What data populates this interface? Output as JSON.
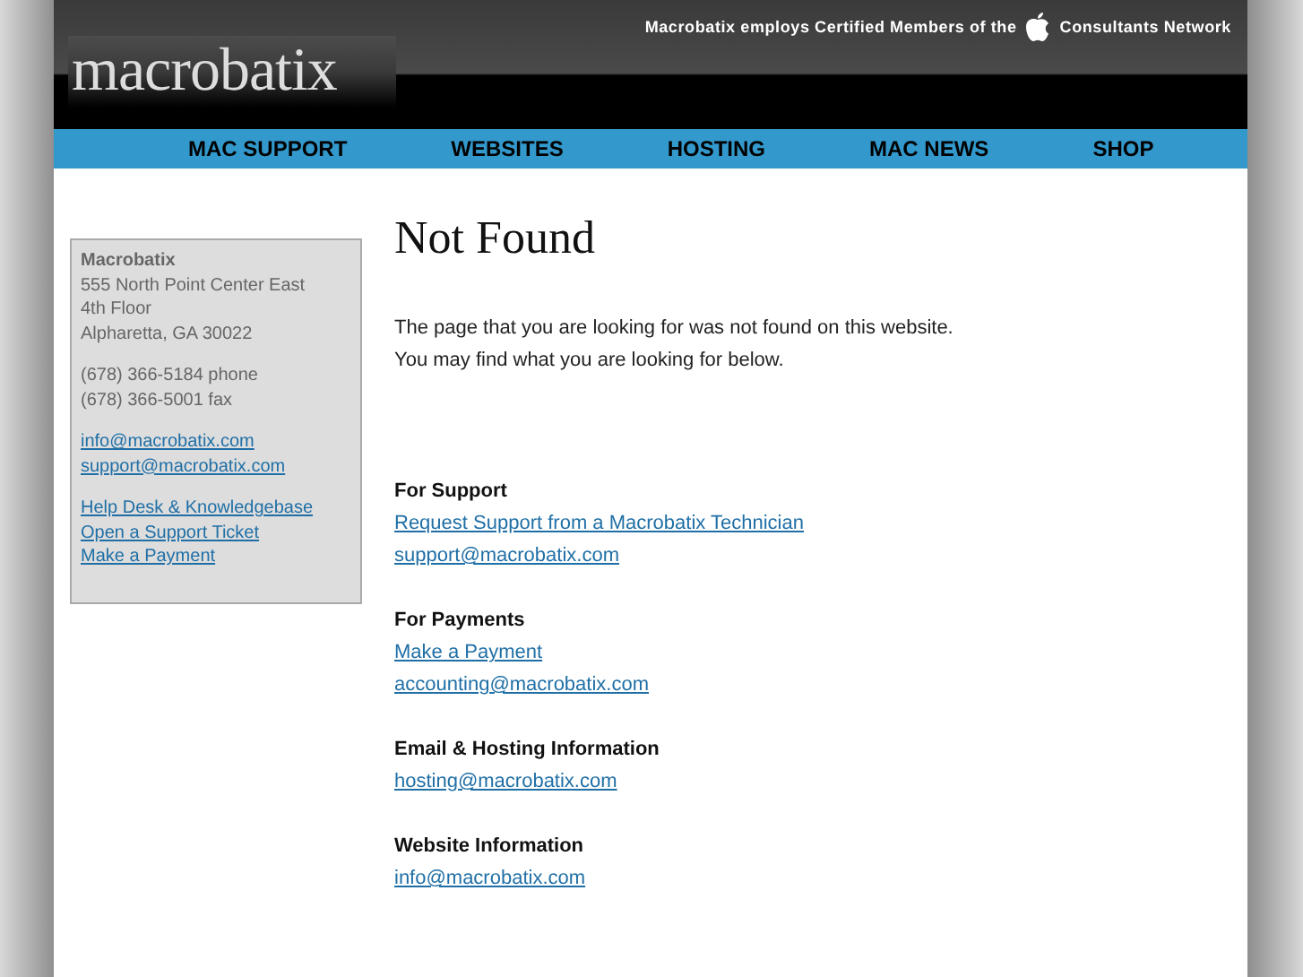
{
  "header": {
    "tagline_start": "Macrobatix employs Certified Members of the",
    "tagline_end": "Consultants Network",
    "logo": "macrobatix"
  },
  "nav": [
    {
      "label": "MAC SUPPORT"
    },
    {
      "label": "WEBSITES"
    },
    {
      "label": "HOSTING"
    },
    {
      "label": "MAC NEWS"
    },
    {
      "label": "SHOP"
    }
  ],
  "sidebar": {
    "name": "Macrobatix",
    "address": [
      "555 North Point Center East",
      "4th Floor",
      "Alpharetta, GA 30022"
    ],
    "phones": [
      "(678) 366-5184 phone",
      "(678) 366-5001 fax"
    ],
    "emails": [
      "info@macrobatix.com",
      "support@macrobatix.com"
    ],
    "links": [
      "Help Desk & Knowledgebase",
      "Open a Support Ticket",
      "Make a Payment"
    ]
  },
  "main": {
    "title": "Not Found",
    "message": [
      "The page that you are looking for was not found on this website.",
      "You may find what you are looking for below."
    ],
    "sections": [
      {
        "heading": "For Support",
        "links": [
          "Request Support from a Macrobatix Technician",
          "support@macrobatix.com"
        ]
      },
      {
        "heading": "For Payments",
        "links": [
          "Make a Payment",
          "accounting@macrobatix.com"
        ]
      },
      {
        "heading": "Email & Hosting Information",
        "links": [
          "hosting@macrobatix.com"
        ]
      },
      {
        "heading": "Website Information",
        "links": [
          "info@macrobatix.com"
        ]
      }
    ]
  }
}
